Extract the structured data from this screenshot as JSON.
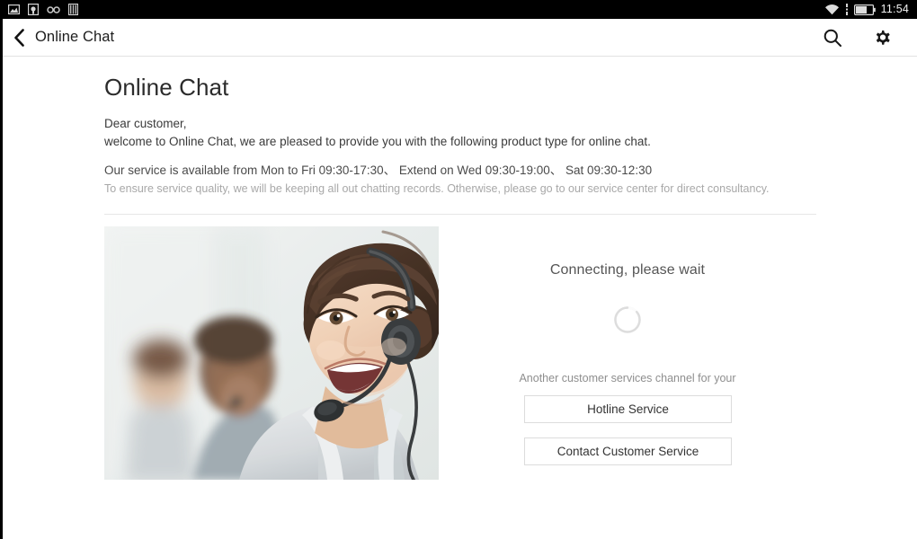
{
  "status_bar": {
    "icons": [
      "image-thumbnail-icon",
      "sd-card-icon",
      "infinity-icon",
      "sim-card-icon"
    ],
    "wifi_icon": "wifi-icon",
    "signal_icon": "signal-dots-icon",
    "battery_icon": "battery-icon",
    "time": "11:54",
    "background": "#000000"
  },
  "app_bar": {
    "back_icon": "back-chevron-icon",
    "title": "Online Chat",
    "search_icon": "search-icon",
    "settings_icon": "gear-icon"
  },
  "main": {
    "page_title": "Online Chat",
    "greeting": "Dear customer,",
    "welcome": "welcome to Online Chat, we are pleased to provide you with the following product type for online chat.",
    "hours": "Our service is available from Mon to Fri 09:30-17:30、 Extend on Wed 09:30-19:00、 Sat 09:30-12:30",
    "notice": "To ensure service quality, we will be keeping all out chatting records. Otherwise, please go to our service center for direct consultancy.",
    "photo_alt": "customer-service-agent-with-headset-photo"
  },
  "right_panel": {
    "connecting_text": "Connecting, please wait",
    "spinner_name": "loading-spinner",
    "channel_note": "Another customer services channel for your",
    "hotline_button": "Hotline Service",
    "contact_button": "Contact Customer Service"
  },
  "colors": {
    "status_bar_bg": "#000000",
    "app_bar_bg": "#ffffff",
    "page_bg": "#ffffff",
    "title_text": "#2b2b2b",
    "body_text": "#3a3a3a",
    "muted_text": "#a8a8a8",
    "button_border": "#dcdcdc",
    "divider": "#e6e6e6"
  }
}
